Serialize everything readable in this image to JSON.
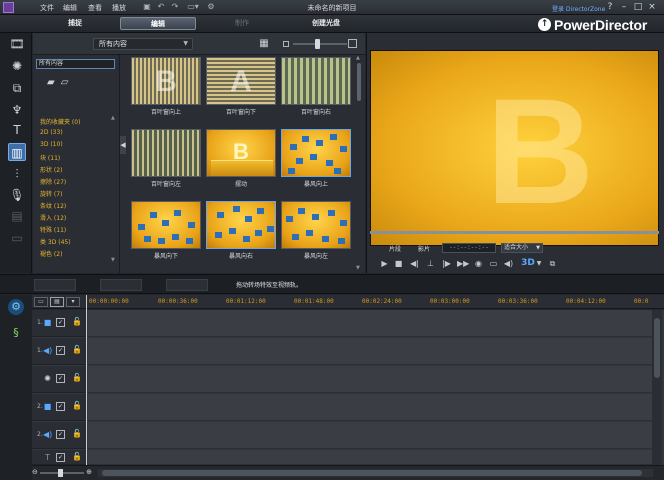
{
  "menu": {
    "items": [
      "文件",
      "编辑",
      "查看",
      "播放"
    ],
    "title": "未命名的新项目",
    "login": "登录 DirectorZone",
    "window_buttons": [
      "?",
      "–",
      "□",
      "×"
    ]
  },
  "modes": {
    "tabs": [
      {
        "label": "捕捉",
        "state": "normal"
      },
      {
        "label": "编辑",
        "state": "active"
      },
      {
        "label": "制作",
        "state": "disabled"
      },
      {
        "label": "创建光盘",
        "state": "normal"
      }
    ],
    "brand": "PowerDirector"
  },
  "left_tools": [
    "media-room-icon",
    "fx-icon",
    "pip-icon",
    "particle-icon",
    "title-icon",
    "transition-icon",
    "audio-mix-icon",
    "voice-over-icon",
    "chapter-icon",
    "subtitle-icon"
  ],
  "library": {
    "content_filter": "所有内容",
    "search_value": "所有内容",
    "categories": [
      "我的收藏夹 (0)",
      "2D (33)",
      "3D (10)",
      "块 (11)",
      "形状 (2)",
      "擦除 (27)",
      "旋转 (7)",
      "条纹 (12)",
      "滑入 (12)",
      "特殊 (11)",
      "类 3D (45)",
      "褪色 (2)"
    ],
    "thumbnails": [
      {
        "caption": "百叶窗向上",
        "letter": "B",
        "style": "stripe-v",
        "selected": false
      },
      {
        "caption": "百叶窗向下",
        "letter": "A",
        "style": "stripe-h",
        "selected": false
      },
      {
        "caption": "百叶窗向右",
        "letter": "",
        "style": "stripe-v",
        "selected": false
      },
      {
        "caption": "百叶窗向左",
        "letter": "",
        "style": "stripe-v",
        "selected": false
      },
      {
        "caption": "摆动",
        "letter": "B",
        "style": "gold",
        "selected": false
      },
      {
        "caption": "暴风向上",
        "letter": "",
        "style": "shatter",
        "selected": true
      },
      {
        "caption": "暴风向下",
        "letter": "",
        "style": "shatter",
        "selected": false
      },
      {
        "caption": "暴风向右",
        "letter": "",
        "style": "shatter",
        "selected": true
      },
      {
        "caption": "暴风向左",
        "letter": "",
        "style": "shatter",
        "selected": false
      }
    ]
  },
  "preview": {
    "letter": "B",
    "clip_label": "片段",
    "movie_label": "影片",
    "timecode": "--:--:--:--",
    "fit": "适合大小",
    "controls": [
      "play-icon",
      "stop-icon",
      "prev-frame-icon",
      "split-icon",
      "next-frame-icon",
      "fast-forward-icon",
      "snapshot-icon",
      "display-icon",
      "volume-icon",
      "3d-icon",
      "undock-icon"
    ],
    "three_d": "3D"
  },
  "hint": "拖动转场特效至视频轨。",
  "timeline": {
    "timecodes": [
      "00:00:00:00",
      "00:00:36:00",
      "00:01:12:00",
      "00:01:48:00",
      "00:02:24:00",
      "00:03:00:00",
      "00:03:36:00",
      "00:04:12:00",
      "00:0"
    ],
    "tracks": [
      {
        "num": "1.",
        "type": "video-track-icon"
      },
      {
        "num": "1.",
        "type": "audio-track-icon"
      },
      {
        "num": "",
        "type": "fx-track-icon"
      },
      {
        "num": "2.",
        "type": "video-track-icon"
      },
      {
        "num": "2.",
        "type": "audio-track-icon"
      },
      {
        "num": "",
        "type": "title-track-icon"
      }
    ]
  }
}
